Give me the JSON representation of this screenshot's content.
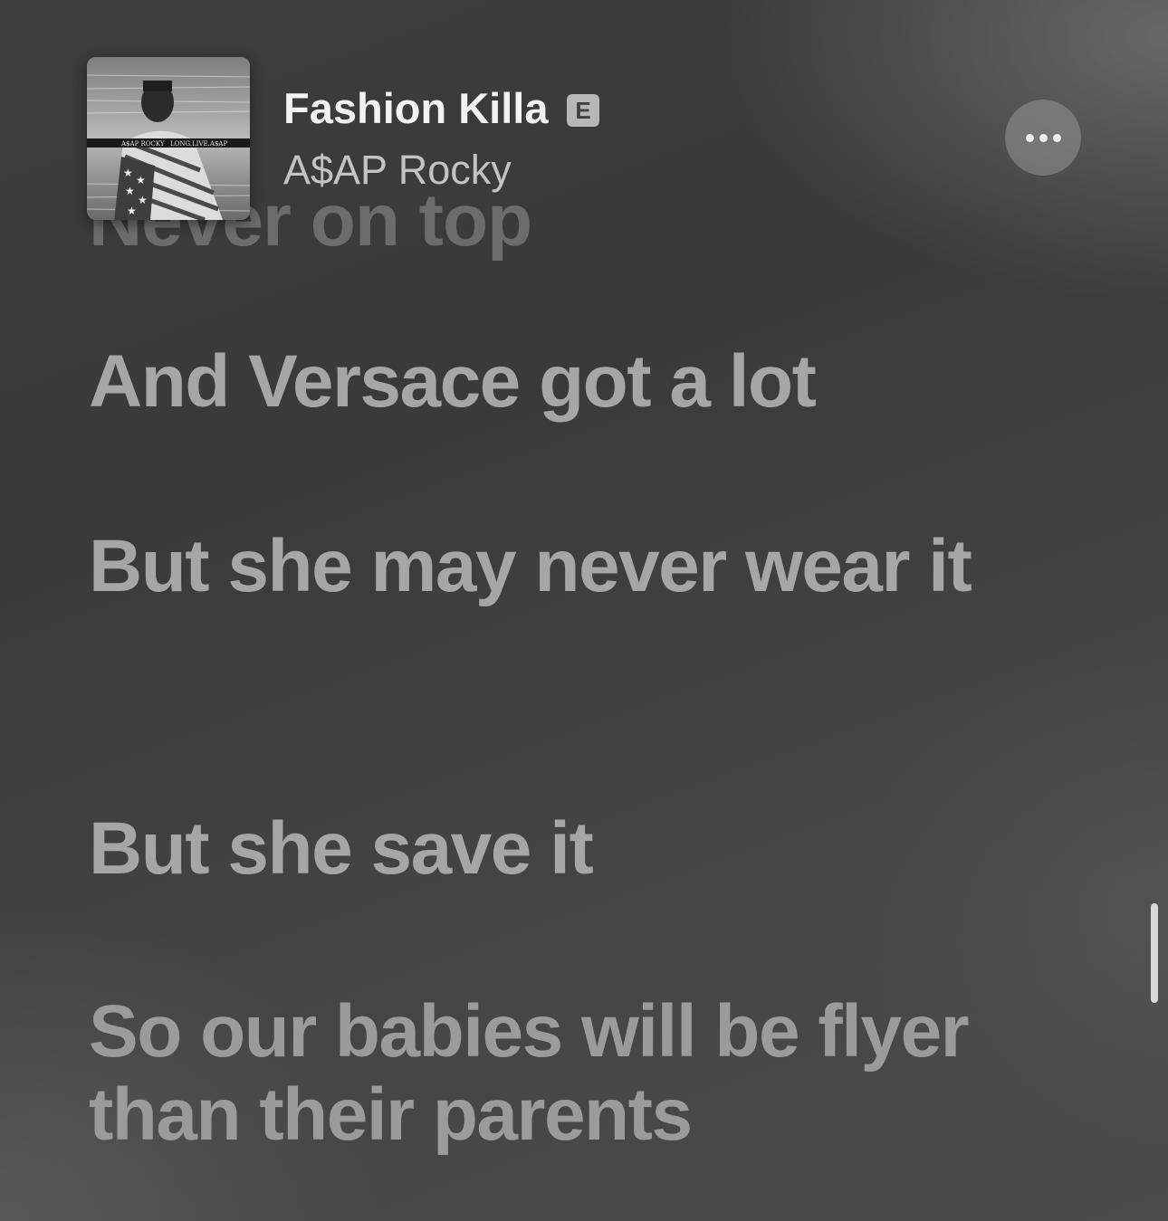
{
  "now_playing": {
    "title": "Fashion Killa",
    "explicit_badge": "E",
    "artist": "A$AP Rocky",
    "artwork": {
      "artist_text": "A$AP ROCKY",
      "album_text": "LONG.LIVE.A$AP"
    },
    "more_icon": "ellipsis-icon"
  },
  "lyrics": {
    "partial_previous": "Never on top",
    "lines": [
      "And Versace got a lot",
      "But she may never wear it",
      "But she save it",
      "So our babies will be flyer than their parents"
    ]
  },
  "colors": {
    "title": "#f2f2f2",
    "artist": "#c3c3c3",
    "lyric": "#a6a6a6",
    "badge_bg": "#b7b7b7"
  }
}
